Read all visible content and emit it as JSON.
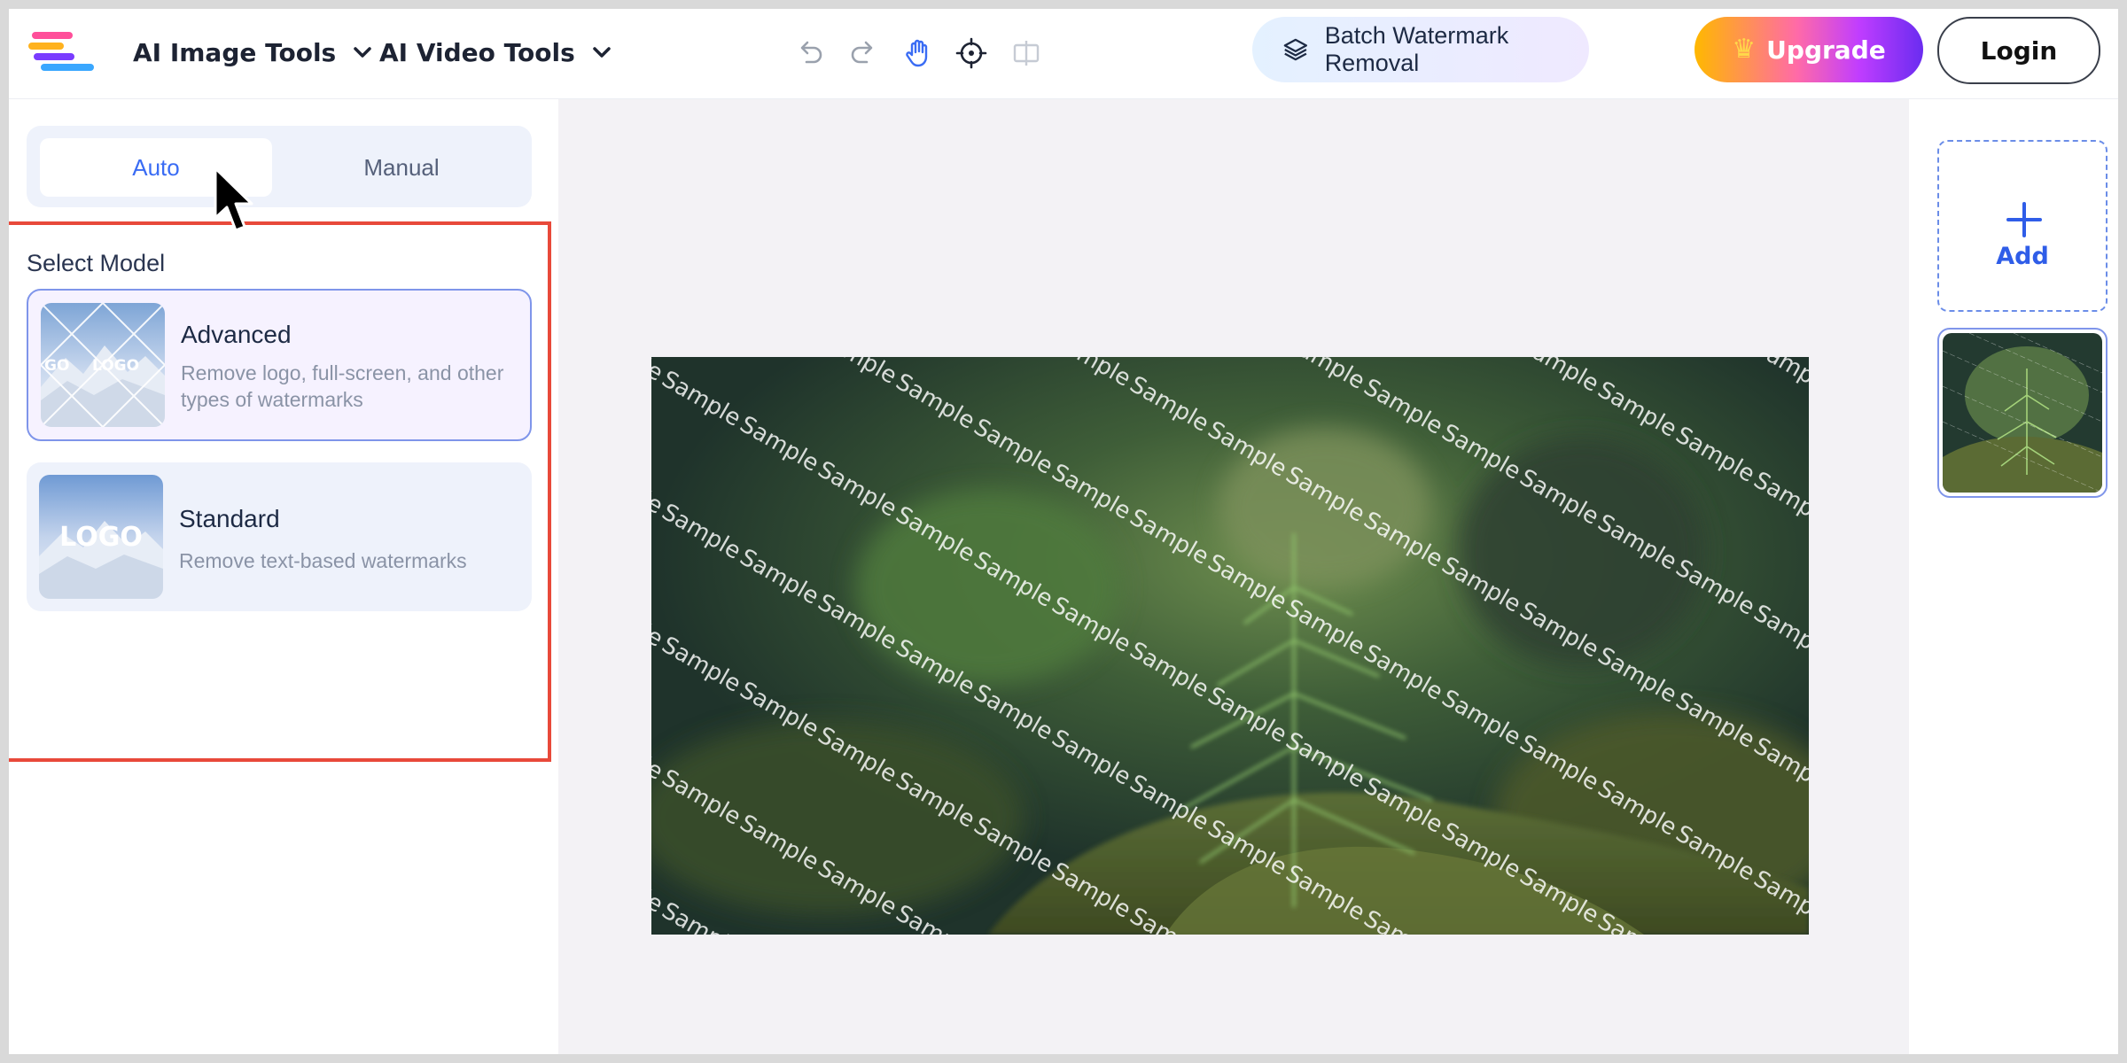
{
  "header": {
    "logo_icon": "layers-e-logo-icon",
    "menus": [
      {
        "label": "AI Image Tools",
        "icon": "chevron-down-icon"
      },
      {
        "label": "AI Video Tools",
        "icon": "chevron-down-icon"
      }
    ],
    "tools": [
      "undo-icon",
      "redo-icon",
      "hand-icon",
      "crosshair-icon",
      "compare-icon"
    ],
    "batch_label": "Batch Watermark Removal",
    "upgrade_label": "Upgrade",
    "login_label": "Login"
  },
  "left_panel": {
    "tabs": [
      {
        "label": "Auto",
        "active": true
      },
      {
        "label": "Manual",
        "active": false
      }
    ],
    "select_model_label": "Select Model",
    "models": [
      {
        "title": "Advanced",
        "description": "Remove logo, full-screen, and other types of watermarks",
        "selected": true
      },
      {
        "title": "Standard",
        "description": "Remove text-based watermarks",
        "selected": false
      }
    ],
    "thumb_text": {
      "advanced_left": "GO",
      "advanced_center": "LOGO",
      "standard": "LOGO"
    }
  },
  "canvas": {
    "watermark_word": "Sample"
  },
  "right_panel": {
    "add_label": "Add"
  },
  "colors": {
    "accent": "#3a6cf4",
    "highlight_border": "#e8493a",
    "canvas_bg": "#f3f2f5"
  }
}
